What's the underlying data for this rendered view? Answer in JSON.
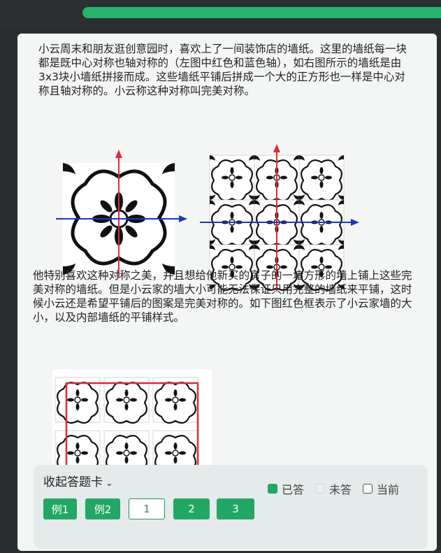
{
  "problem": {
    "paragraph1": "小云周末和朋友逛创意园时，喜欢上了一间装饰店的墙纸。这里的墙纸每一块都是既中心对称也轴对称的（左图中红色和蓝色轴），如右图所示的墙纸是由3x3块小墙纸拼接而成。这些墙纸平铺后拼成一个大的正方形也一样是中心对称且轴对称的。小云称这种对称叫完美对称。",
    "paragraph2": "他特别喜欢这种对称之美，并且想给他新买的房子的一堵方形的墙上铺上这些完美对称的墙纸。但是小云家的墙大小可能无法保证只用完整的墙纸来平铺，这时候小云还是希望平铺后的图案是完美对称的。如下图红色框表示了小云家墙的大小，以及内部墙纸的平铺样式。"
  },
  "answer_card": {
    "title": "收起答题卡",
    "legend": {
      "done": "已答",
      "undone": "未答",
      "current": "当前"
    },
    "buttons": [
      "例1",
      "例2",
      "1",
      "2",
      "3"
    ]
  },
  "colors": {
    "accent": "#22a765",
    "red_axis": "#e0293a",
    "blue_axis": "#1c35c8"
  }
}
